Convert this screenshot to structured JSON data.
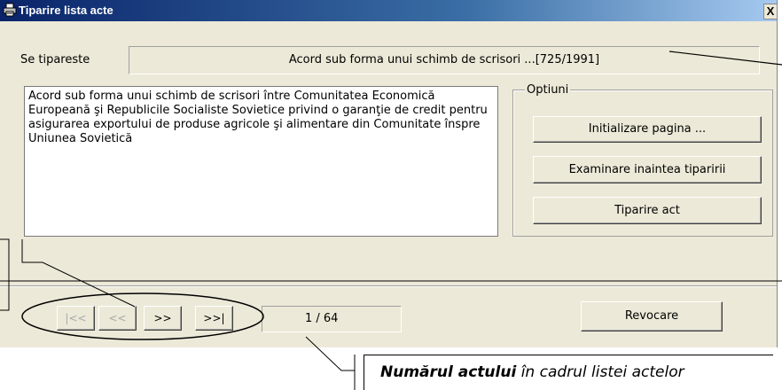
{
  "window": {
    "title": "Tiparire lista acte",
    "close_label": "X"
  },
  "print_row": {
    "label": "Se tipareste",
    "value": "Acord sub forma unui schimb de scrisori ...[725/1991]"
  },
  "document_text": "Acord sub forma unui schimb de scrisori între Comunitatea Economică Europeană şi Republicile Socialiste Sovietice privind o garanţie de credit pentru asigurarea exportului de produse agricole şi alimentare din Comunitate înspre Uniunea Sovietică",
  "options": {
    "title": "Optiuni",
    "init_page": "Initializare pagina ...",
    "preview": "Examinare inaintea tiparirii",
    "print_act": "Tiparire act"
  },
  "navigation": {
    "first": "|<<",
    "prev": "<<",
    "next": ">>",
    "last": ">>|",
    "position": "1 / 64"
  },
  "cancel_label": "Revocare",
  "callout": {
    "bold": "Numărul actului",
    "rest": " în cadrul listei actelor"
  }
}
